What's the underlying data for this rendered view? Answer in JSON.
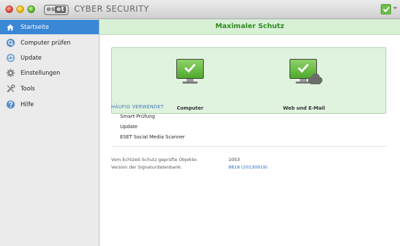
{
  "window": {
    "brand_logo_left": "es",
    "brand_logo_right": "et",
    "product_title": "CYBER SECURITY"
  },
  "colors": {
    "active_item": "#3a87d6",
    "status_green": "#2f8a1f",
    "panel_bg": "#dff3df",
    "header_bg": "#d8f0d6",
    "link_blue": "#2a6bc4"
  },
  "sidebar": {
    "items": [
      {
        "label": "Startseite",
        "icon": "home-icon",
        "active": true
      },
      {
        "label": "Computer prüfen",
        "icon": "scan-icon",
        "active": false
      },
      {
        "label": "Update",
        "icon": "update-icon",
        "active": false
      },
      {
        "label": "Einstellungen",
        "icon": "gear-icon",
        "active": false
      },
      {
        "label": "Tools",
        "icon": "tools-icon",
        "active": false
      },
      {
        "label": "Hilfe",
        "icon": "help-icon",
        "active": false
      }
    ]
  },
  "main": {
    "header_title": "Maximaler Schutz",
    "status": {
      "computer_label": "Computer",
      "web_mail_label": "Web und E-Mail"
    },
    "frequently_used": {
      "title": "HÄUFIG VERWENDET",
      "items": [
        "Smart-Prüfung",
        "Update",
        "ESET Social Media Scanner"
      ]
    },
    "info": {
      "realtime_label": "Vom Echtzeit-Schutz geprüfte Objekte:",
      "realtime_value": "1053",
      "signature_label": "Version der Signaturdatenbank:",
      "signature_value": "8819 (20130919)"
    }
  }
}
